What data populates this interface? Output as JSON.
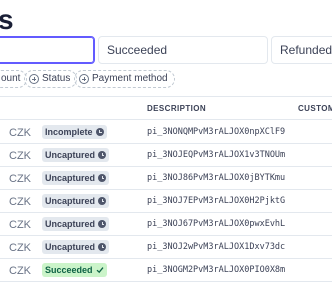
{
  "page": {
    "title_fragment": "s"
  },
  "filters": {
    "tabs": [
      {
        "label": "",
        "active": true
      },
      {
        "label": "Succeeded",
        "active": false
      },
      {
        "label": "Refunded",
        "active": false
      }
    ],
    "chips": [
      {
        "label": "ount"
      },
      {
        "label": "Status"
      },
      {
        "label": "Payment method"
      }
    ]
  },
  "table": {
    "headers": {
      "description": "DESCRIPTION",
      "customer": "CUSTOME"
    },
    "rows": [
      {
        "currency": "CZK",
        "status": "Incomplete",
        "status_icon": "clock-icon",
        "description": "pi_3NONQMPvM3rALJOX0npXClF9"
      },
      {
        "currency": "CZK",
        "status": "Uncaptured",
        "status_icon": "clock-icon",
        "description": "pi_3NOJEQPvM3rALJOX1v3TNOUm"
      },
      {
        "currency": "CZK",
        "status": "Uncaptured",
        "status_icon": "clock-icon",
        "description": "pi_3NOJ86PvM3rALJOX0jBYTKmu"
      },
      {
        "currency": "CZK",
        "status": "Uncaptured",
        "status_icon": "clock-icon",
        "description": "pi_3NOJ7EPvM3rALJOX0H2PjktG"
      },
      {
        "currency": "CZK",
        "status": "Uncaptured",
        "status_icon": "clock-icon",
        "description": "pi_3NOJ67PvM3rALJOX0pwxEvhL"
      },
      {
        "currency": "CZK",
        "status": "Uncaptured",
        "status_icon": "clock-icon",
        "description": "pi_3NOJ2wPvM3rALJOX1Dxv73dc"
      },
      {
        "currency": "CZK",
        "status": "Succeeded",
        "status_icon": "check-icon",
        "description": "pi_3NOGM2PvM3rALJOX0PIO0X8m"
      }
    ]
  },
  "colors": {
    "accent": "#635bff",
    "success_bg": "#cbf4c9",
    "success_text": "#0e6245",
    "neutral_badge": "#e3e8ee"
  }
}
